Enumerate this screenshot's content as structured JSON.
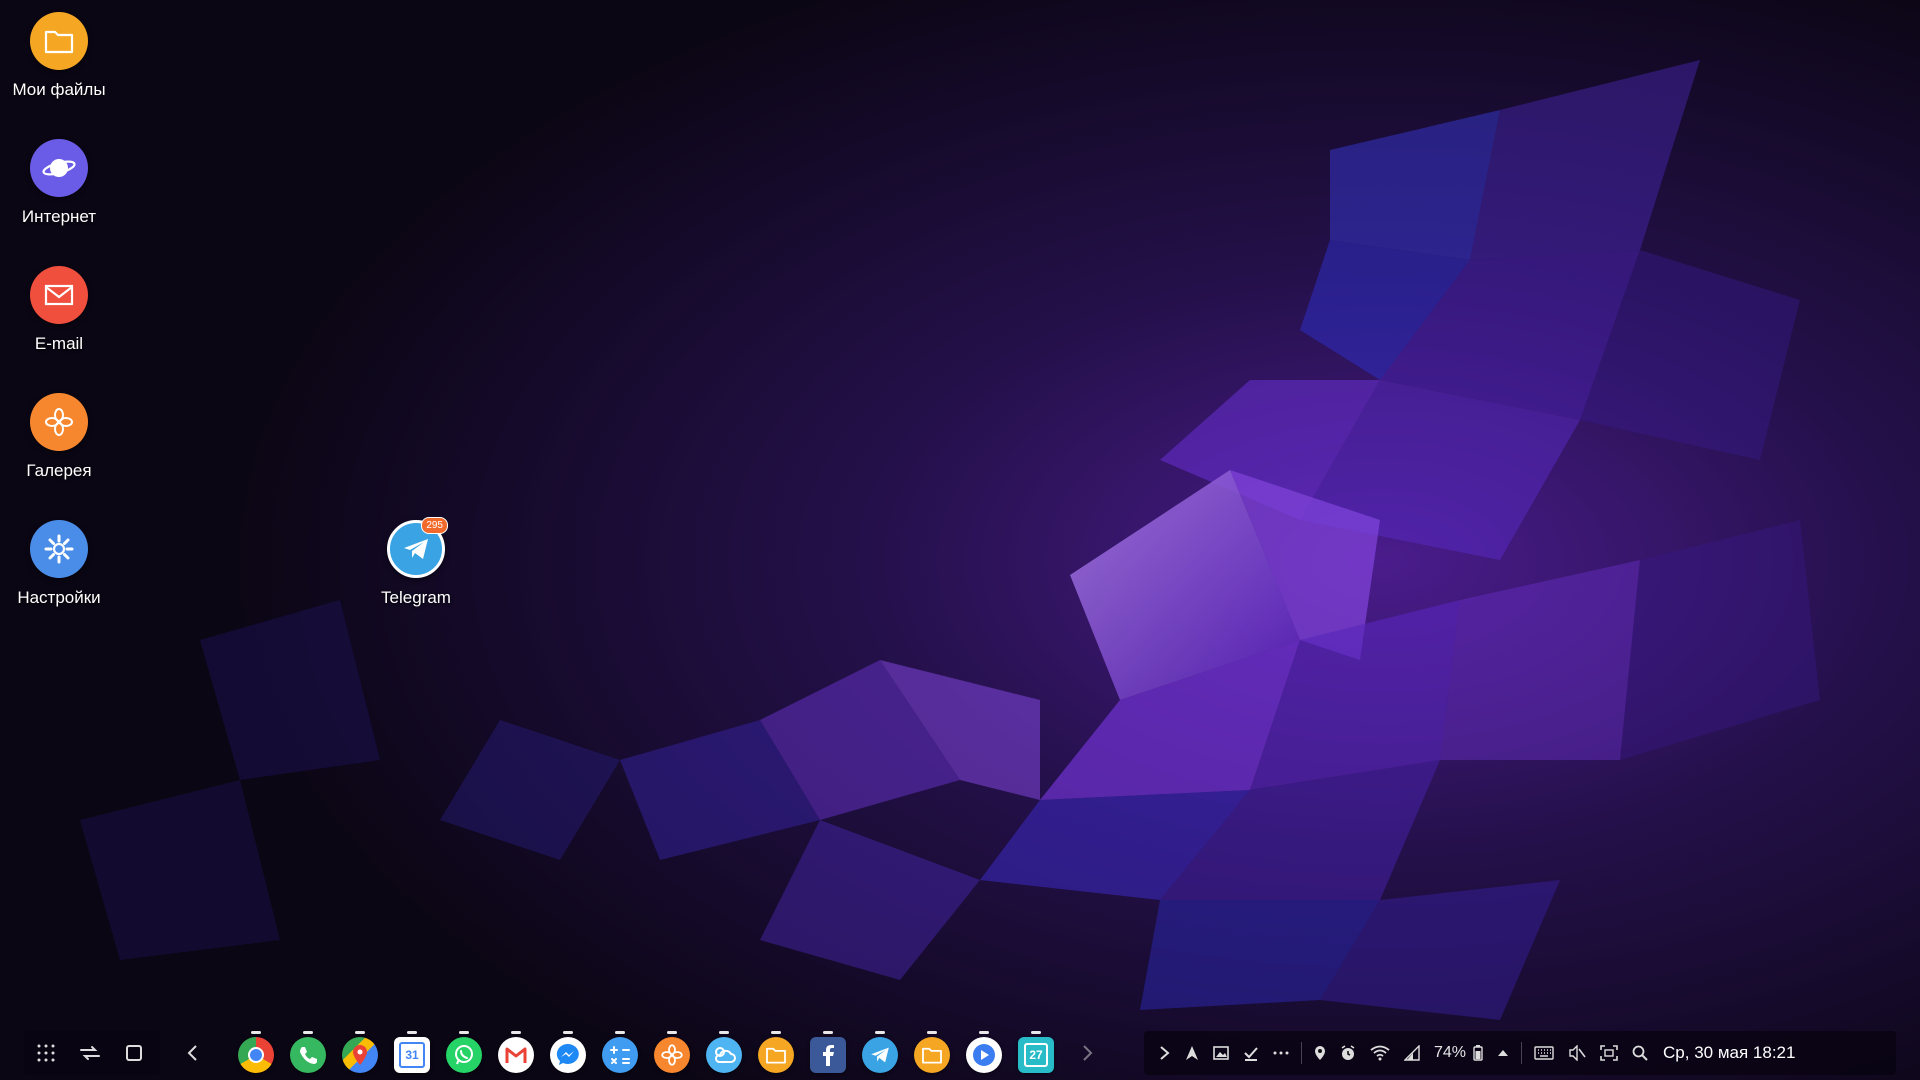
{
  "desktop": {
    "icons": [
      {
        "label": "Мои файлы",
        "icon": "folder-icon",
        "color": "#f5a623"
      },
      {
        "label": "Интернет",
        "icon": "planet-icon",
        "color": "#6b5ce7"
      },
      {
        "label": "E-mail",
        "icon": "envelope-icon",
        "color": "#f04f3d"
      },
      {
        "label": "Галерея",
        "icon": "flower-icon",
        "color": "#f7872e"
      },
      {
        "label": "Настройки",
        "icon": "gear-icon",
        "color": "#4a8de8"
      },
      {
        "label": "Telegram",
        "icon": "telegram-icon",
        "color": "#3aa3e3",
        "badge": "295"
      }
    ]
  },
  "taskbar": {
    "nav": [
      "apps-grid-icon",
      "recents-icon",
      "home-icon"
    ],
    "dock_prev": "chevron-left-icon",
    "dock_next": "chevron-right-icon",
    "dock": [
      {
        "name": "Chrome",
        "icon": "chrome-icon"
      },
      {
        "name": "Phone",
        "icon": "phone-icon"
      },
      {
        "name": "Maps",
        "icon": "maps-icon"
      },
      {
        "name": "Calendar",
        "icon": "calendar-icon",
        "text": "31"
      },
      {
        "name": "WhatsApp",
        "icon": "whatsapp-icon"
      },
      {
        "name": "Gmail",
        "icon": "gmail-icon"
      },
      {
        "name": "Messenger",
        "icon": "messenger-icon"
      },
      {
        "name": "Calculator",
        "icon": "calculator-icon"
      },
      {
        "name": "Gallery",
        "icon": "flower-icon"
      },
      {
        "name": "Weather",
        "icon": "weather-icon"
      },
      {
        "name": "My Files",
        "icon": "folder-icon"
      },
      {
        "name": "Facebook",
        "icon": "facebook-icon"
      },
      {
        "name": "Telegram",
        "icon": "telegram-icon"
      },
      {
        "name": "Files",
        "icon": "folder-icon"
      },
      {
        "name": "Video",
        "icon": "play-icon"
      },
      {
        "name": "Calendar",
        "icon": "calendar-icon",
        "text": "27"
      }
    ],
    "tray": {
      "battery": "74%",
      "datetime": "Ср, 30 мая 18:21",
      "icons": [
        "expand-icon",
        "navigation-icon",
        "screenshot-icon",
        "download-done-icon",
        "more-icon",
        "location-icon",
        "alarm-icon",
        "wifi-icon",
        "signal-icon",
        "battery-icon",
        "notification-up-icon",
        "keyboard-icon",
        "mute-icon",
        "screen-capture-icon",
        "search-icon"
      ]
    }
  },
  "colors": {
    "accent": "#7b3fe4",
    "background": "#0d0718"
  }
}
